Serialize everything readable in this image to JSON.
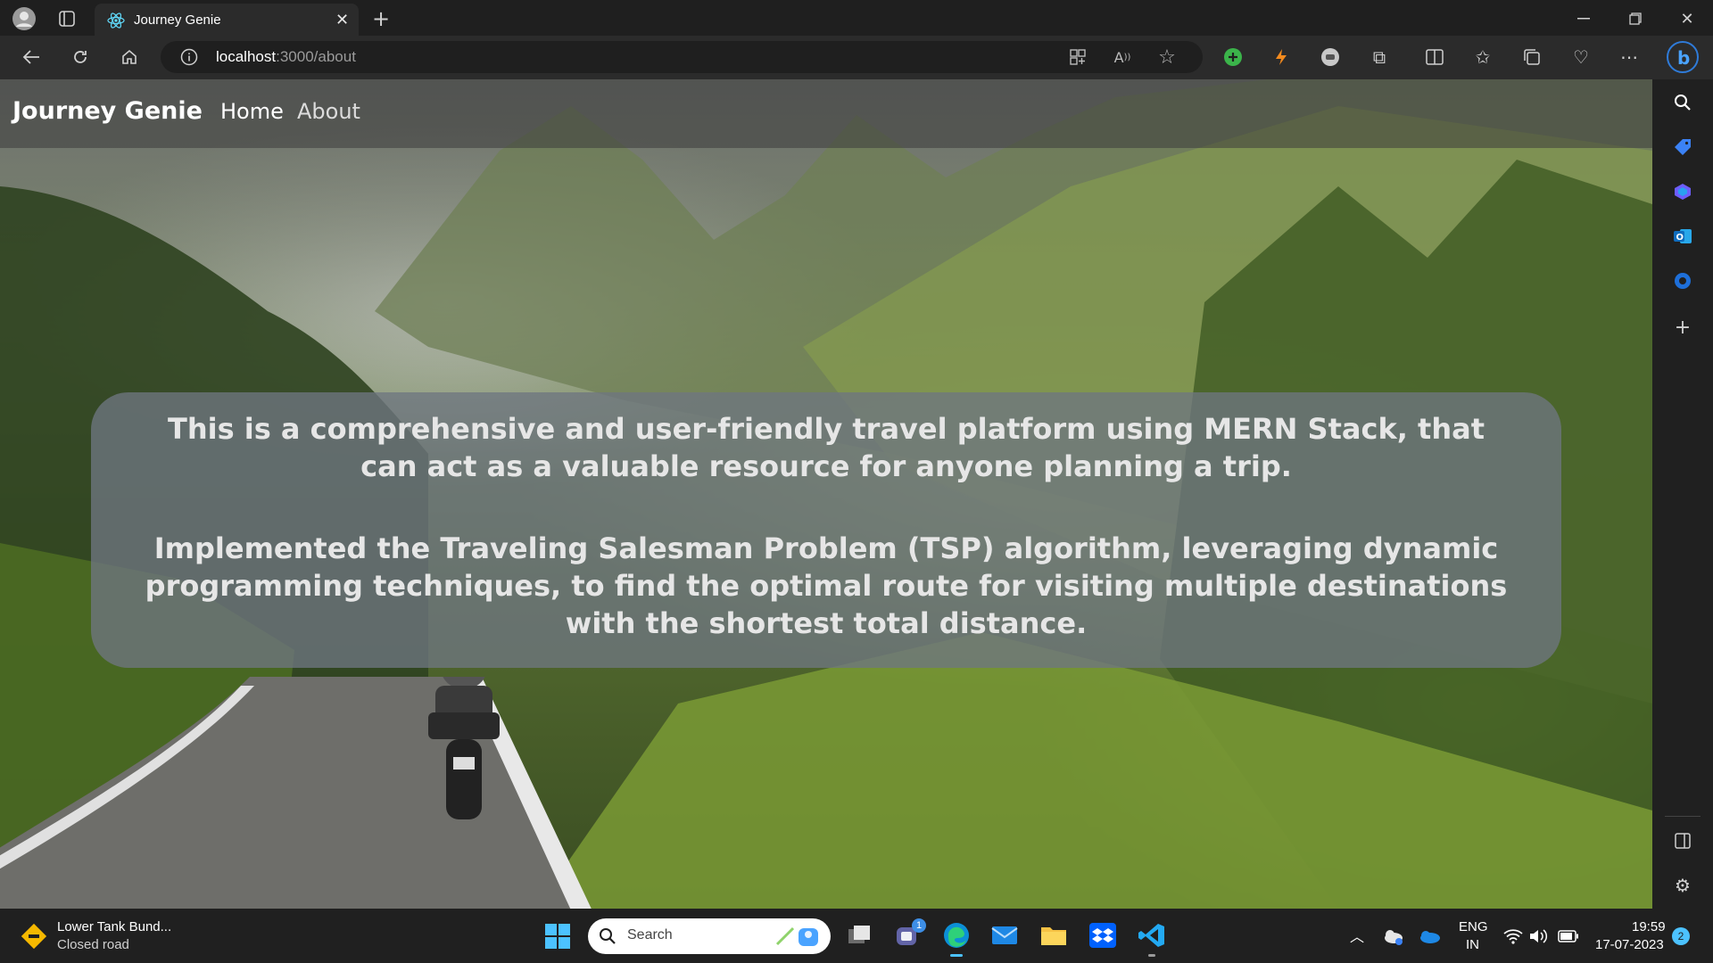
{
  "browser": {
    "tab_title": "Journey Genie",
    "address": {
      "host": "localhost",
      "path": ":3000/about"
    }
  },
  "site": {
    "brand": "Journey Genie",
    "nav": [
      {
        "label": "Home"
      },
      {
        "label": "About"
      }
    ],
    "about": {
      "paragraph1": "This is a comprehensive and user-friendly travel platform using MERN Stack, that can act as a valuable resource for anyone planning a trip.",
      "paragraph2": "Implemented the Traveling Salesman Problem (TSP) algorithm, leveraging dynamic programming techniques, to find the optimal route for visiting multiple destinations with the shortest total distance."
    }
  },
  "taskbar": {
    "news_title": "Lower Tank Bund...",
    "news_sub": "Closed road",
    "search_placeholder": "Search",
    "lang_top": "ENG",
    "lang_bottom": "IN",
    "time": "19:59",
    "date": "17-07-2023",
    "notification_count": "2",
    "chat_badge": "1"
  },
  "colors": {
    "accent": "#0078d4",
    "chrome_bg": "#1f1f1f",
    "toolbar_bg": "#2b2b2b",
    "card_bg": "#6e7680"
  }
}
